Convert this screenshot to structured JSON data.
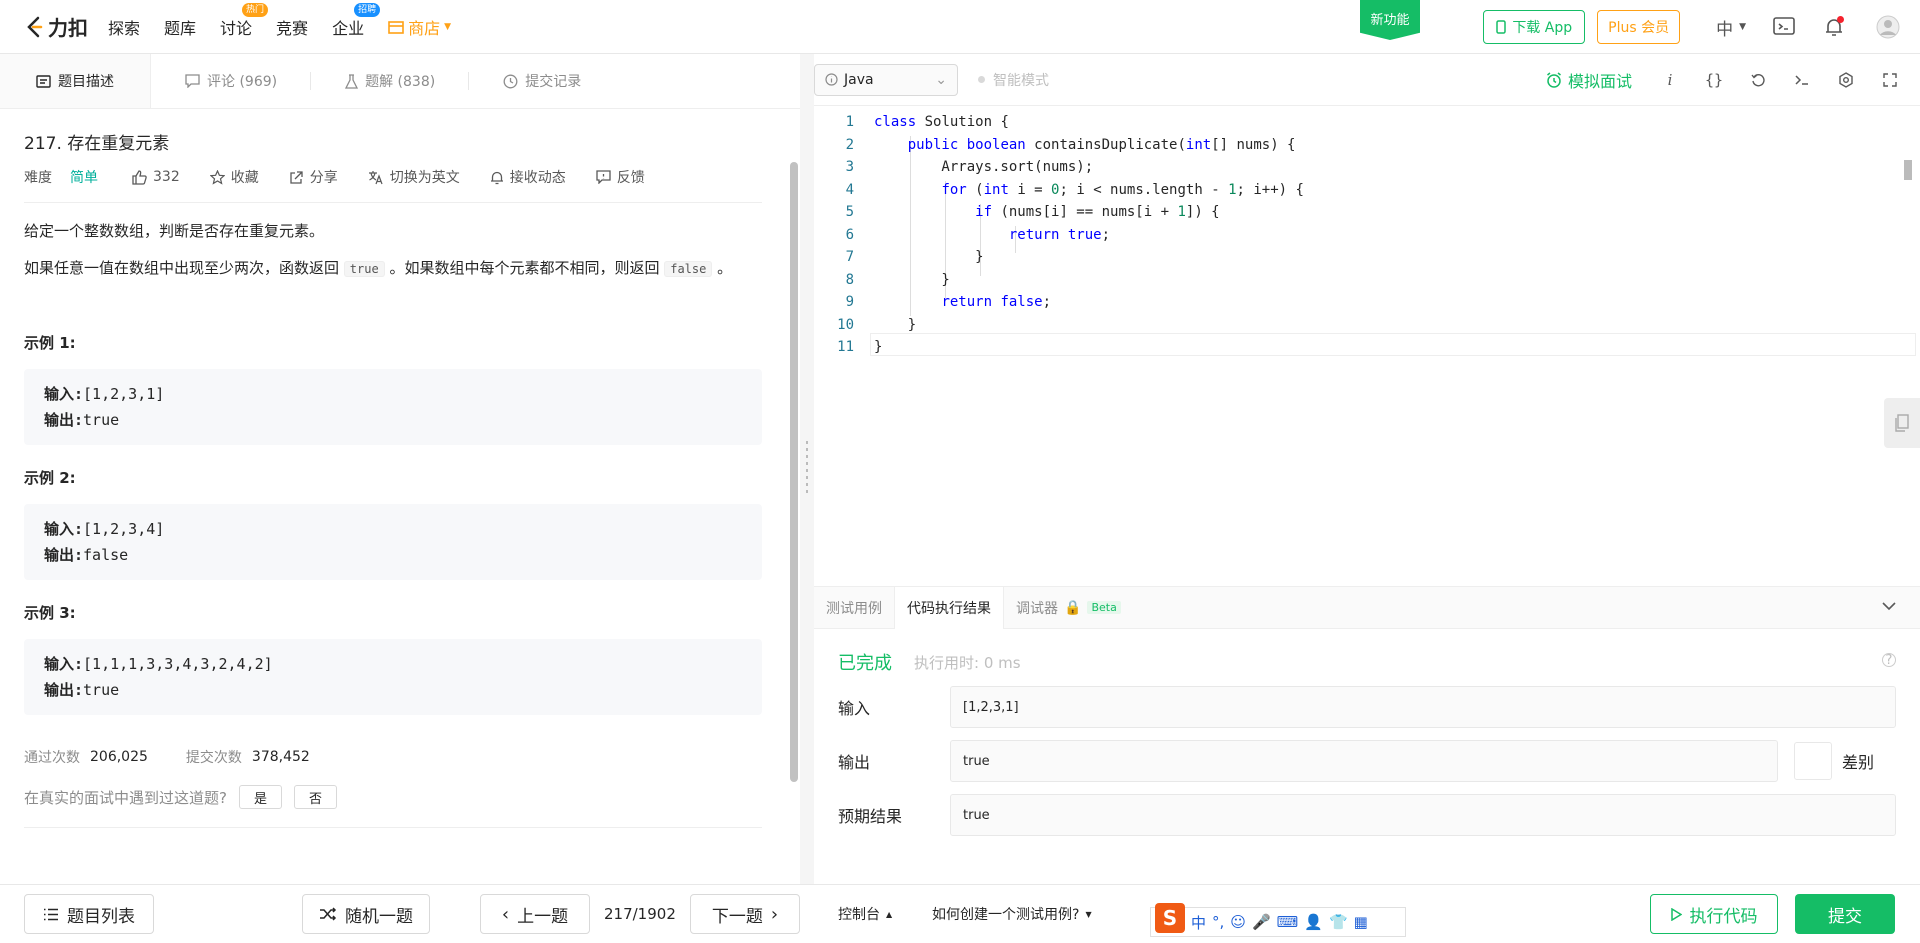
{
  "nav": {
    "logo_text": "力扣",
    "items": [
      {
        "label": "探索"
      },
      {
        "label": "题库"
      },
      {
        "label": "讨论",
        "badge": "热门"
      },
      {
        "label": "竞赛"
      },
      {
        "label": "企业",
        "badge": "招聘"
      }
    ],
    "shop_label": "商店",
    "new_feature": "新功能",
    "download_app": "下载 App",
    "plus": "Plus 会员",
    "language": "中"
  },
  "left_tabs": [
    {
      "label": "题目描述",
      "icon": "description-icon"
    },
    {
      "label": "评论 (969)",
      "icon": "comment-icon"
    },
    {
      "label": "题解 (838)",
      "icon": "flask-icon"
    },
    {
      "label": "提交记录",
      "icon": "clock-icon"
    }
  ],
  "problem": {
    "title": "217. 存在重复元素",
    "difficulty_label": "难度",
    "difficulty": "简单",
    "likes": "332",
    "favorite": "收藏",
    "share": "分享",
    "switch_lang": "切换为英文",
    "subscribe": "接收动态",
    "feedback": "反馈",
    "para1": "给定一个整数数组，判断是否存在重复元素。",
    "para2_a": "如果任意一值在数组中出现至少两次，函数返回 ",
    "para2_code1": "true",
    "para2_b": " 。如果数组中每个元素都不相同，则返回 ",
    "para2_code2": "false",
    "para2_c": " 。",
    "examples": [
      {
        "title": "示例 1:",
        "input_label": "输入:",
        "input": "[1,2,3,1]",
        "output_label": "输出:",
        "output": "true"
      },
      {
        "title": "示例 2:",
        "input_label": "输入:",
        "input": "[1,2,3,4]",
        "output_label": "输出:",
        "output": "false"
      },
      {
        "title": "示例 3:",
        "input_label": "输入:",
        "input": "[1,1,1,3,3,4,3,2,4,2]",
        "output_label": "输出:",
        "output": "true"
      }
    ],
    "accepted_label": "通过次数",
    "accepted": "206,025",
    "submissions_label": "提交次数",
    "submissions": "378,452",
    "interview_question": "在真实的面试中遇到过这道题?",
    "yes": "是",
    "no": "否"
  },
  "editor": {
    "language": "Java",
    "smart_mode": "智能模式",
    "mock_interview": "模拟面试",
    "lines": [
      "1",
      "2",
      "3",
      "4",
      "5",
      "6",
      "7",
      "8",
      "9",
      "10",
      "11"
    ]
  },
  "console": {
    "tabs": [
      "测试用例",
      "代码执行结果",
      "调试器"
    ],
    "beta": "Beta",
    "status": "已完成",
    "exec_time": "执行用时: 0 ms",
    "input_label": "输入",
    "input_value": "[1,2,3,1]",
    "output_label": "输出",
    "output_value": "true",
    "diff_label": "差别",
    "expected_label": "预期结果",
    "expected_value": "true"
  },
  "footer": {
    "problem_list": "题目列表",
    "random": "随机一题",
    "prev": "上一题",
    "pager": "217/1902",
    "next": "下一题",
    "console": "控制台",
    "how_to_test": "如何创建一个测试用例?",
    "run": "执行代码",
    "submit": "提交"
  },
  "colors": {
    "brand_green": "#15bd66",
    "orange": "#ffa116",
    "easy": "#00af9b"
  }
}
